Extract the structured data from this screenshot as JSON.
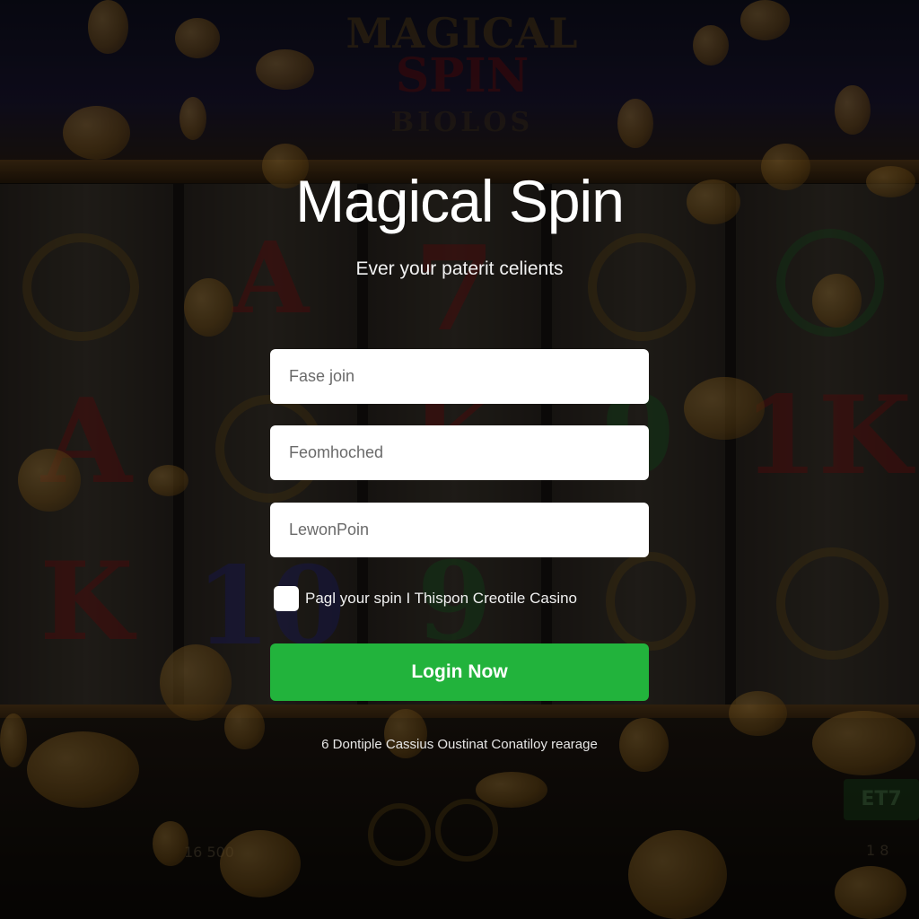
{
  "app": {
    "title": "Magical Spin",
    "subtitle": "Ever your paterit celients"
  },
  "background": {
    "logo_line1": "MAGICAL",
    "logo_line2": "SPIN",
    "logo_line3": "BIOLOS",
    "badge_right": "ET7",
    "counter_left": "16 500",
    "counter_right": "1 8"
  },
  "form": {
    "field1_placeholder": "Fase join",
    "field2_placeholder": "Feomhoched",
    "field3_placeholder": "LewonPoin",
    "remember_label": "Pagl your spin  I Thispon Creotile Casino",
    "remember_checked": false,
    "login_button": "Login Now",
    "footer_text": "6 Dontiple Cassius Oustinat Conatiloy rearage"
  },
  "colors": {
    "accent_green": "#22b33c",
    "field_bg": "#ffffff",
    "title_text": "#ffffff"
  }
}
